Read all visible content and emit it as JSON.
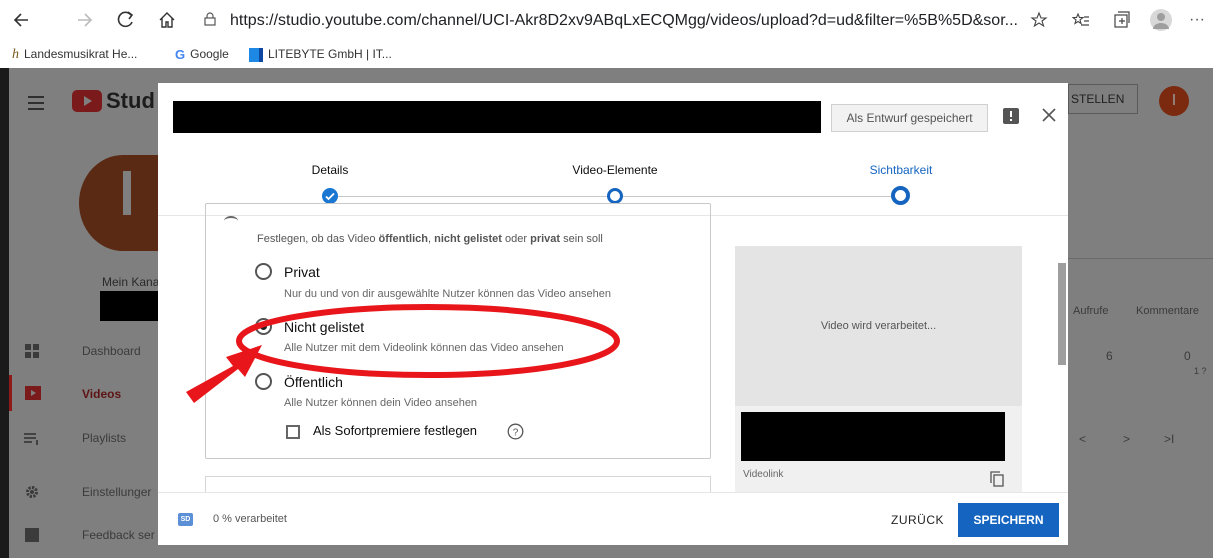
{
  "browser": {
    "url": "https://studio.youtube.com/channel/UCI-Akr8D2xv9ABqLxECQMgg/videos/upload?d=ud&filter=%5B%5D&sor...",
    "icons": [
      "back-arrow-icon",
      "forward-arrow-icon",
      "refresh-icon",
      "home-icon",
      "lock-icon",
      "star-icon",
      "favorites-icon",
      "collections-icon",
      "profile-icon",
      "more-icon"
    ],
    "bookmarks": [
      {
        "label": "Landesmusikrat He...",
        "icon": "landesmusikrat-favicon"
      },
      {
        "label": "Google",
        "icon": "google-favicon"
      },
      {
        "label": "LITEBYTE GmbH | IT...",
        "icon": "litebyte-favicon"
      }
    ]
  },
  "studio": {
    "logo_text": "Stud",
    "avatar_letter": "I",
    "channel_label": "Mein Kana",
    "create_button": "STELLEN",
    "header_avatar_letter": "I",
    "nav": [
      {
        "label": "Dashboard",
        "icon": "dashboard-icon"
      },
      {
        "label": "Videos",
        "icon": "videos-icon",
        "active": true
      },
      {
        "label": "Playlists",
        "icon": "playlists-icon"
      },
      {
        "label": "Einstellunger",
        "icon": "settings-icon"
      },
      {
        "label": "Feedback ser",
        "icon": "feedback-icon"
      }
    ],
    "table_headers": [
      "Aufrufe",
      "Kommentare"
    ],
    "table_values": [
      "6",
      "0"
    ],
    "row_hint": "1 ?",
    "pager": [
      "<",
      ">",
      ">I"
    ]
  },
  "modal": {
    "draft_status": "Als Entwurf gespeichert",
    "steps": [
      {
        "label": "Details",
        "state": "done"
      },
      {
        "label": "Video-Elemente",
        "state": "pending"
      },
      {
        "label": "Sichtbarkeit",
        "state": "current"
      }
    ],
    "visibility": {
      "description_parts": [
        "Festlegen, ob das Video ",
        "öffentlich",
        ", ",
        "nicht gelistet",
        " oder ",
        "privat",
        " sein soll"
      ],
      "options": [
        {
          "label": "Privat",
          "hint": "Nur du und von dir ausgewählte Nutzer können das Video ansehen",
          "checked": false
        },
        {
          "label": "Nicht gelistet",
          "hint": "Alle Nutzer mit dem Videolink können das Video ansehen",
          "checked": true
        },
        {
          "label": "Öffentlich",
          "hint": "Alle Nutzer können dein Video ansehen",
          "checked": false
        }
      ],
      "premiere_checkbox": "Als Sofortpremiere festlegen"
    },
    "preview": {
      "processing": "Video wird verarbeitet...",
      "link_label": "Videolink"
    },
    "footer": {
      "badge": "SD",
      "progress": "0 % verarbeitet",
      "progress_fraction": 0,
      "back": "ZURÜCK",
      "save": "SPEICHERN"
    }
  },
  "colors": {
    "accent": "#1565c0",
    "annotation": "#e8161b"
  }
}
